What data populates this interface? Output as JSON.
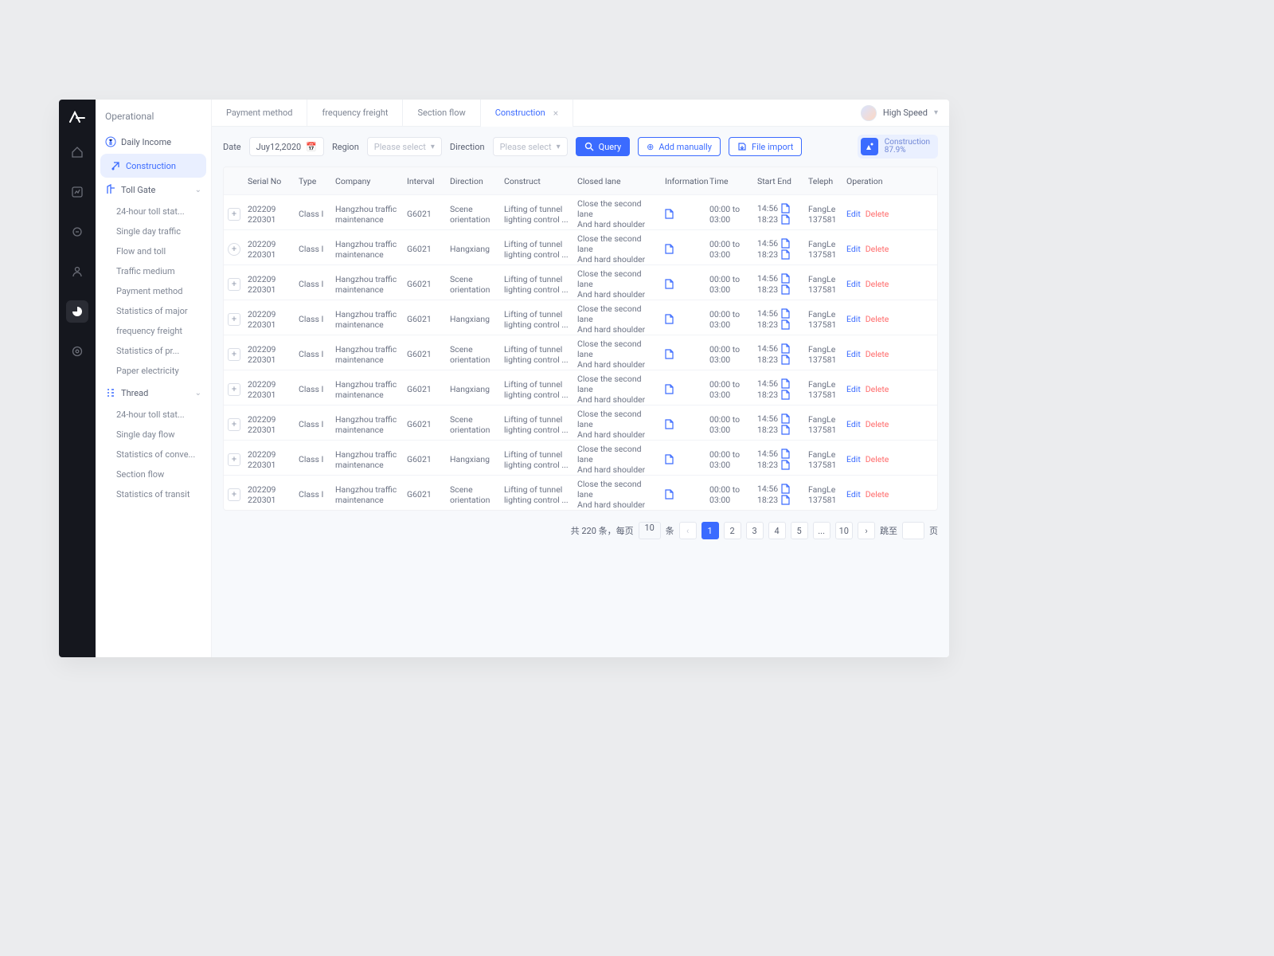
{
  "sidebar": {
    "title": "Operational",
    "daily_income": "Daily Income",
    "construction": "Construction",
    "toll_gate": "Toll Gate",
    "toll_children": [
      "24-hour toll stat...",
      "Single day traffic",
      "Flow and toll",
      "Traffic medium",
      "Payment method",
      "Statistics of major",
      "frequency freight",
      "Statistics of pr...",
      "Paper electricity"
    ],
    "thread": "Thread",
    "thread_children": [
      "24-hour toll stat...",
      "Single day flow",
      "Statistics of conve...",
      "Section flow",
      "Statistics of transit"
    ]
  },
  "tabs": [
    "Payment method",
    "frequency freight",
    "Section flow",
    "Construction"
  ],
  "user": {
    "name": "High Speed"
  },
  "filters": {
    "date_label": "Date",
    "date_value": "Juy12,2020",
    "region_label": "Region",
    "region_ph": "Please select",
    "direction_label": "Direction",
    "direction_ph": "Please select",
    "query": "Query",
    "add": "Add manually",
    "import": "File import",
    "badge_title": "Construction",
    "badge_value": "87.9%"
  },
  "columns": [
    "",
    "Serial No",
    "Type",
    "Company",
    "Interval",
    "Direction",
    "Construct",
    "Closed lane",
    "Information",
    "Time",
    "Start End",
    "Teleph",
    "Operation"
  ],
  "row": {
    "serial_a": "202209",
    "serial_b": "220301",
    "type": "Class I",
    "company_a": "Hangzhou traffic",
    "company_b": "maintenance",
    "interval": "G6021",
    "dir_scene_a": "Scene",
    "dir_scene_b": "orientation",
    "dir_hang": "Hangxiang",
    "construct_a": "Lifting of tunnel",
    "construct_b": "lighting control ...",
    "closed_a": "Close the second lane",
    "closed_b": "And hard shoulder",
    "time_a": "00:00 to",
    "time_b": "03:00",
    "se_a": "14:56",
    "se_b": "18:23",
    "tel_a": "FangLe",
    "tel_b": "137581",
    "edit": "Edit",
    "del": "Delete"
  },
  "pager": {
    "summary": "共 220 条，每页",
    "per_page": "10",
    "tiao": "条",
    "pages": [
      "1",
      "2",
      "3",
      "4",
      "5",
      "...",
      "10"
    ],
    "jump_label": "跳至",
    "page_suffix": "页"
  }
}
